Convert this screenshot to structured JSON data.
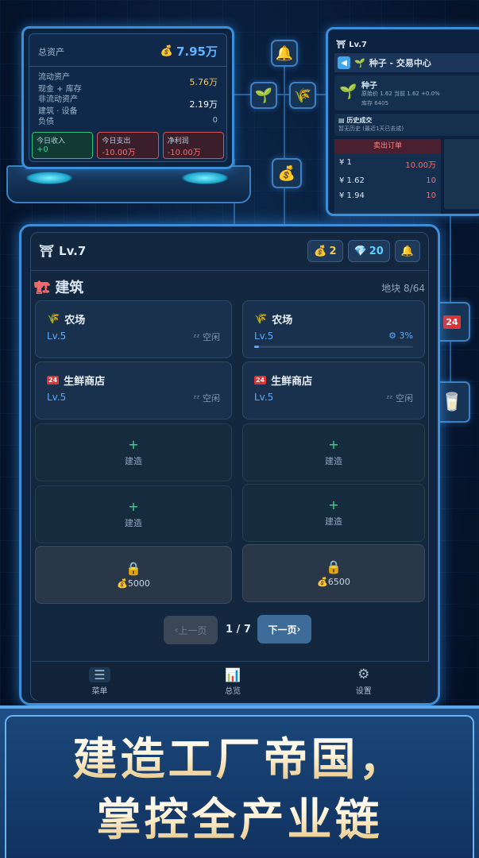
{
  "laptop": {
    "total_assets_label": "总资产",
    "total_assets_value": "7.95万",
    "current_assets_label": "流动资产",
    "current_assets_sub": "现金 + 库存",
    "current_assets_value": "5.76万",
    "noncurrent_assets_label": "非流动资产",
    "noncurrent_assets_sub": "建筑 · 设备",
    "noncurrent_assets_value": "2.19万",
    "liabilities_label": "负债",
    "liabilities_value": "0",
    "today_income_label": "今日收入",
    "today_income_value": "+0",
    "today_expense_label": "今日支出",
    "today_expense_value": "-10.00万",
    "net_profit_label": "净利润",
    "net_profit_value": "-10.00万"
  },
  "trade": {
    "header": "Lv.7",
    "title": "种子 - 交易中心",
    "item_name": "种子",
    "item_price_line": "原始价 1.62  当前 1.62 +0.0%",
    "stock": "库存 6405",
    "history_label": "历史成交",
    "history_sub": "暂无历史 (最近1天已去成)",
    "sell_orders_label": "卖出订单",
    "orders": [
      {
        "price": "¥ 1",
        "qty": "10.00万"
      },
      {
        "price": "¥ 1.62",
        "qty": "10"
      },
      {
        "price": "¥ 1.94",
        "qty": "10"
      }
    ]
  },
  "header": {
    "level": "Lv.7",
    "coins": "2",
    "gems": "20"
  },
  "section": {
    "title": "建筑",
    "plots": "地块 8/64"
  },
  "slots": [
    {
      "name": "农场",
      "level": "Lv.5",
      "status": "空闲"
    },
    {
      "name": "农场",
      "level": "Lv.5",
      "status": "3%",
      "progress": 0.03
    },
    {
      "name": "生鲜商店",
      "level": "Lv.5",
      "status": "空闲"
    },
    {
      "name": "生鲜商店",
      "level": "Lv.5",
      "status": "空闲"
    }
  ],
  "empty_label": "建造",
  "locked": [
    {
      "price": "5000"
    },
    {
      "price": "6500"
    }
  ],
  "pagination": {
    "prev": "上一页",
    "current": "1 / 7",
    "next": "下一页"
  },
  "tabs": [
    {
      "label": "菜单"
    },
    {
      "label": "总览"
    },
    {
      "label": "设置"
    }
  ],
  "banner": {
    "line1": "建造工厂帝国，",
    "line2": "掌控全产业链"
  },
  "colors": {
    "accent": "#3b8ed8",
    "level_blue": "#58a9ff",
    "positive": "#39d98a",
    "negative": "#ff6b6b",
    "gold": "#f6c945"
  },
  "icons": [
    "money-bag-icon",
    "bell-icon",
    "sprout-icon",
    "wheat-icon",
    "gem-icon",
    "store-24-icon",
    "groceries-icon",
    "lock-icon",
    "menu-icon",
    "chart-icon",
    "gear-icon",
    "building-icon"
  ]
}
